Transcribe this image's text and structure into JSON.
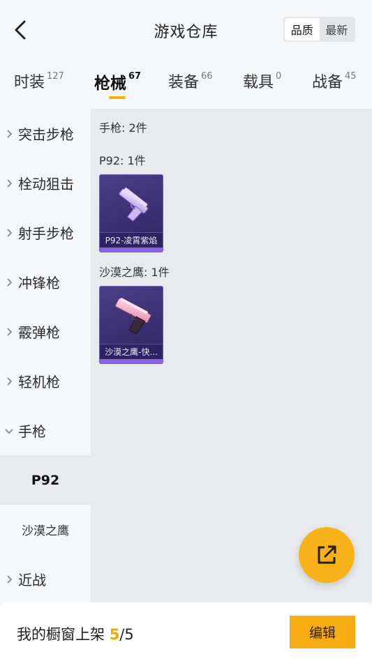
{
  "header": {
    "title": "游戏仓库",
    "sort_options": [
      "品质",
      "最新"
    ],
    "sort_selected": "品质"
  },
  "tabs": [
    {
      "label": "时装",
      "count": "127"
    },
    {
      "label": "枪械",
      "count": "67"
    },
    {
      "label": "装备",
      "count": "66"
    },
    {
      "label": "载具",
      "count": "0"
    },
    {
      "label": "战备",
      "count": "45"
    }
  ],
  "active_tab": "枪械",
  "sidebar": {
    "categories": [
      "突击步枪",
      "栓动狙击",
      "射手步枪",
      "冲锋枪",
      "霰弹枪",
      "轻机枪",
      "手枪",
      "近战"
    ],
    "expanded": "手枪",
    "subitems": [
      "P92",
      "沙漠之鹰"
    ],
    "active_subitem": "P92"
  },
  "content": {
    "summary": "手枪: 2件",
    "groups": [
      {
        "heading": "P92: 1件",
        "items": [
          {
            "name": "P92-凌霄紫焰"
          }
        ]
      },
      {
        "heading": "沙漠之鹰: 1件",
        "items": [
          {
            "name": "沙漠之鹰-快..."
          }
        ]
      }
    ]
  },
  "footer": {
    "showcase_label": "我的橱窗上架",
    "current": "5",
    "separator": "/",
    "total": "5",
    "edit_label": "编辑"
  },
  "colors": {
    "accent": "#f7ad12",
    "card_bg": "#3a2f72",
    "rarity_purple": "#8a66e6"
  },
  "icons": {
    "back": "chevron-left-icon",
    "expand": "chevron-right-icon",
    "collapse": "chevron-down-icon",
    "share": "external-link-icon"
  }
}
